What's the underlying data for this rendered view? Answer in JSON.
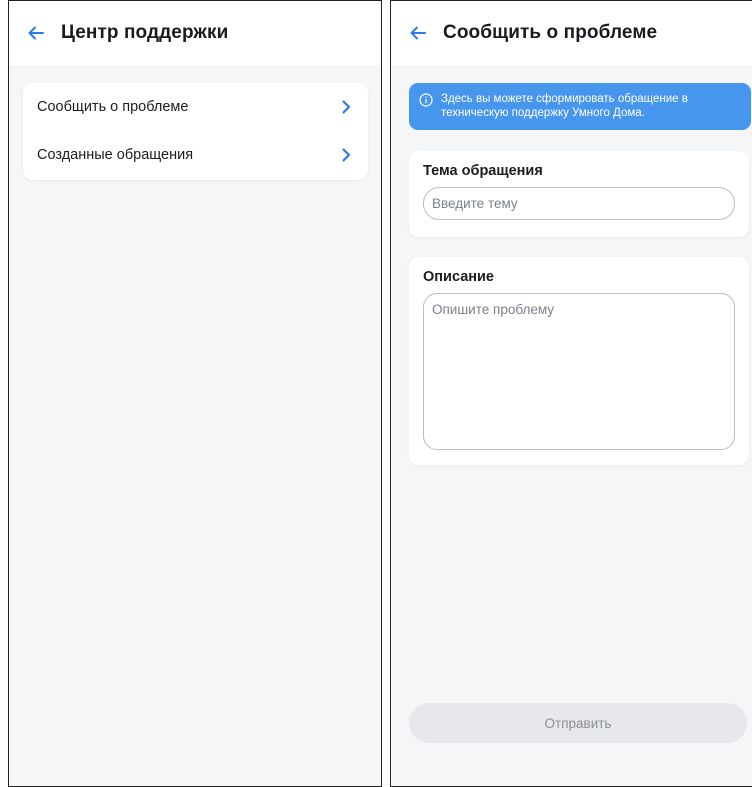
{
  "left_screen": {
    "header": {
      "title": "Центр поддержки",
      "back_icon": "arrow-left-icon"
    },
    "menu": [
      {
        "label": "Сообщить о проблеме",
        "icon": "chevron-right-icon"
      },
      {
        "label": "Созданные обращения",
        "icon": "chevron-right-icon"
      }
    ]
  },
  "right_screen": {
    "header": {
      "title": "Сообщить о проблеме",
      "back_icon": "arrow-left-icon"
    },
    "info_banner": {
      "icon": "info-icon",
      "text": "Здесь вы можете сформировать обращение в техническую поддержку Умного Дома."
    },
    "topic": {
      "label": "Тема обращения",
      "placeholder": "Введите тему",
      "value": ""
    },
    "description": {
      "label": "Описание",
      "placeholder": "Опишите проблему",
      "value": ""
    },
    "submit_label": "Отправить"
  },
  "colors": {
    "accent": "#2f7be5",
    "banner": "#4796ee",
    "background": "#f4f6f8",
    "button_disabled": "#e6e8eb"
  }
}
